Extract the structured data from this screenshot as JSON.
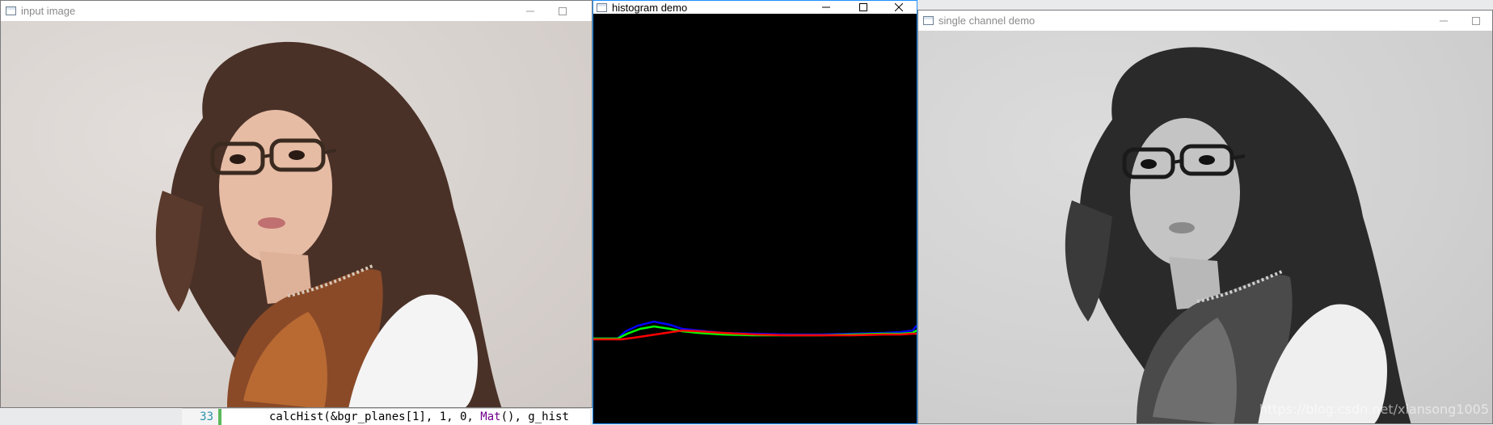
{
  "windows": {
    "input": {
      "title": "input image"
    },
    "histogram": {
      "title": "histogram demo"
    },
    "single": {
      "title": "single channel demo"
    }
  },
  "editor": {
    "line_number": "33",
    "code_prefix": "calcHist(&bgr_planes[1], 1, 0, ",
    "code_keyword": "Mat",
    "code_suffix": "(), g_hist"
  },
  "watermark": "https://blog.csdn.net/xiansong1005",
  "histogram": {
    "series_colors": {
      "blue": "#0000ff",
      "green": "#00ff00",
      "red": "#ff0000"
    }
  },
  "colors": {
    "histogram_background": "#000000",
    "active_border": "#1e90ff"
  }
}
